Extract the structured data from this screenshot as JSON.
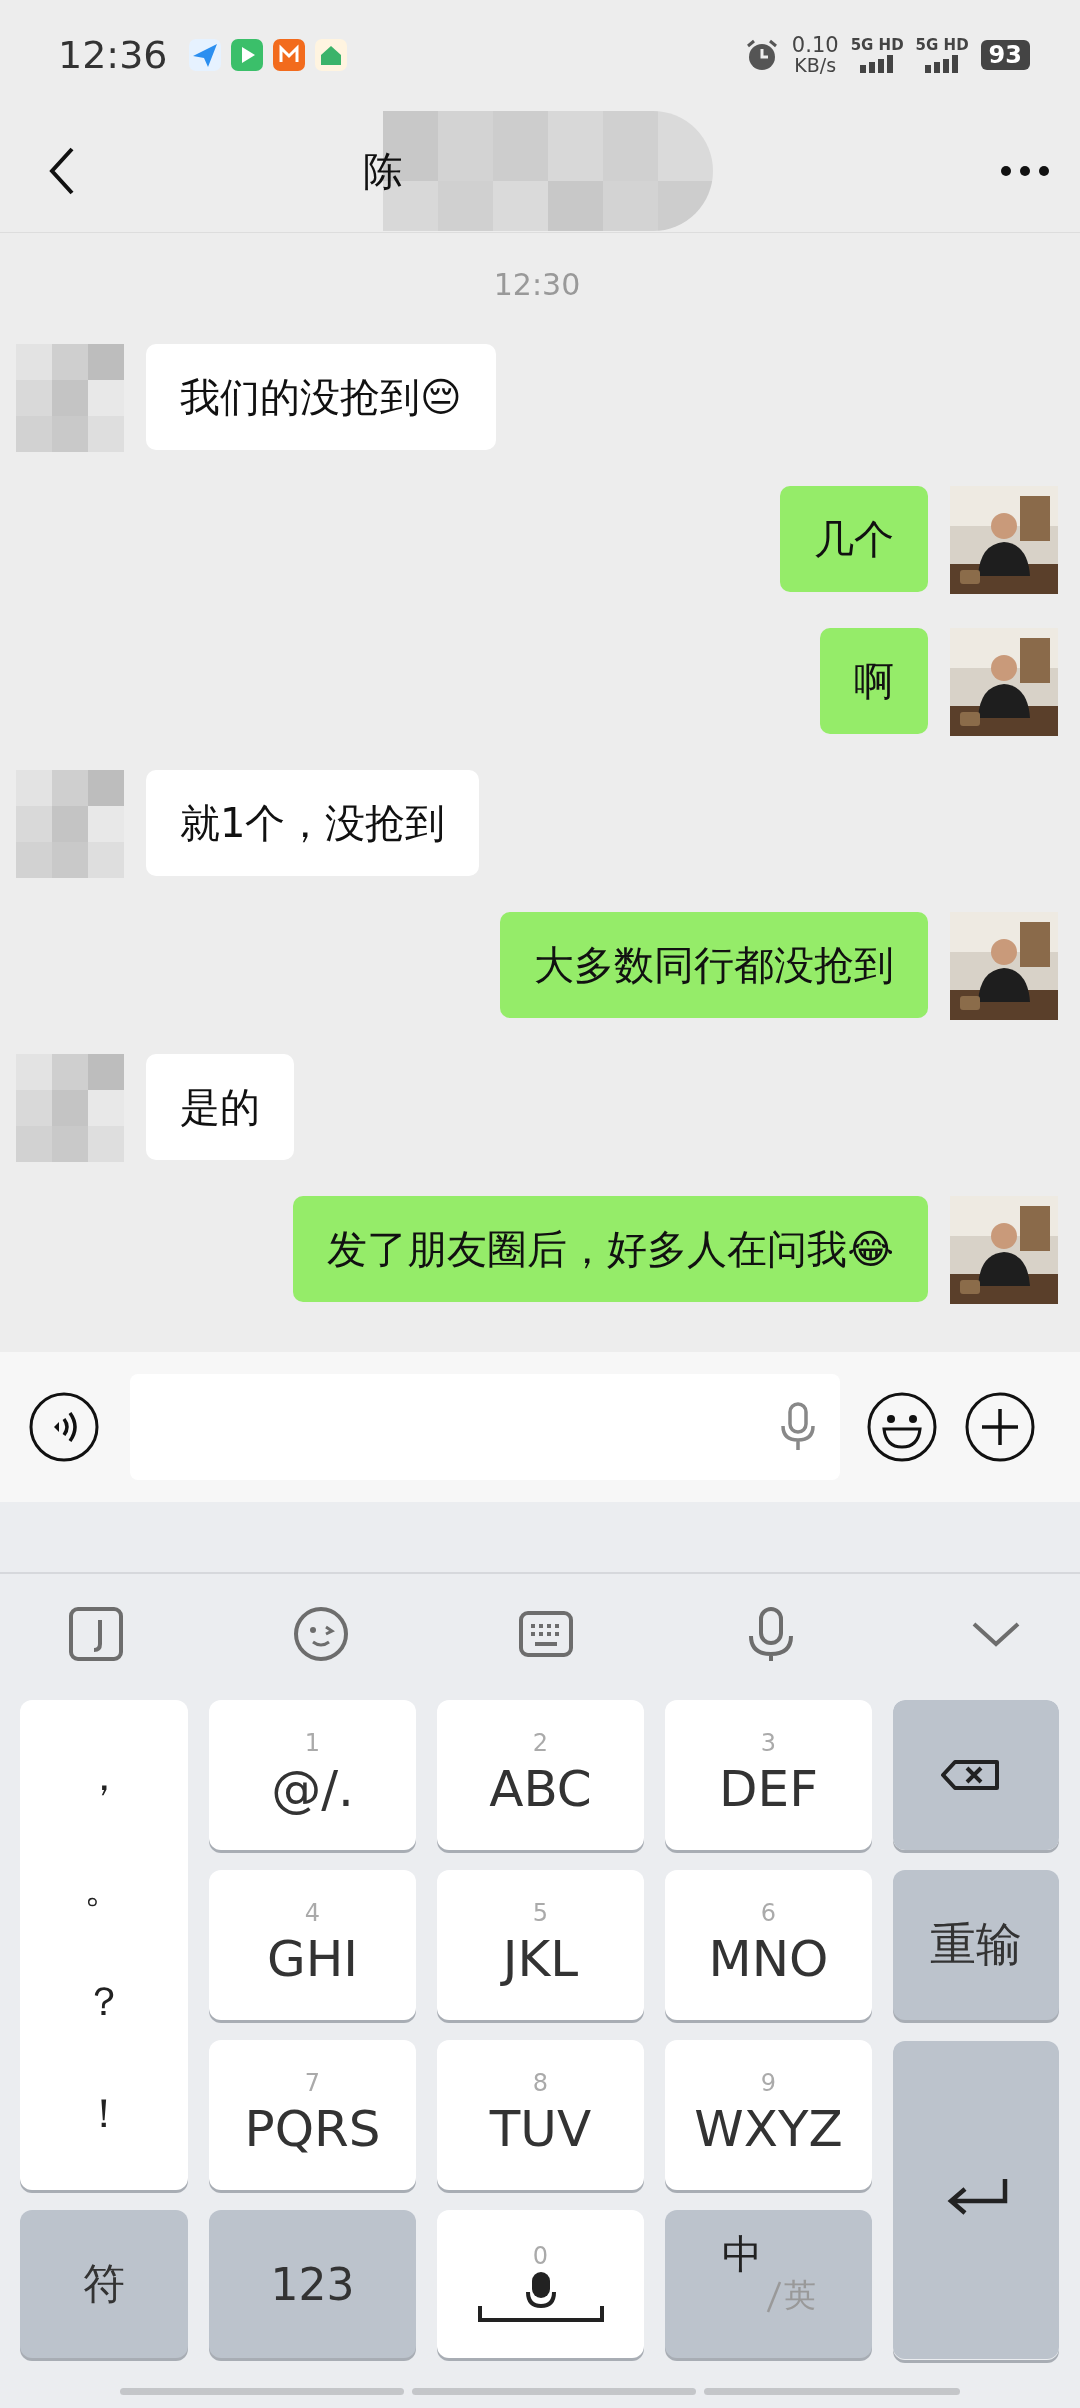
{
  "status_bar": {
    "time": "12:36",
    "net_speed": "0.10",
    "net_unit": "KB/s",
    "sim": [
      "5G HD",
      "5G HD"
    ],
    "battery": "93"
  },
  "header": {
    "title": "陈"
  },
  "chat": {
    "timestamp": "12:30",
    "messages": [
      {
        "kind": "in",
        "text": "我们的没抢到😔"
      },
      {
        "kind": "out",
        "text": "几个"
      },
      {
        "kind": "out",
        "text": "啊"
      },
      {
        "kind": "in",
        "text": "就1个，没抢到"
      },
      {
        "kind": "out",
        "text": "大多数同行都没抢到"
      },
      {
        "kind": "in",
        "text": "是的"
      },
      {
        "kind": "out",
        "text": "发了朋友圈后，好多人在问我😂"
      }
    ]
  },
  "keyboard": {
    "side_keys": [
      "，",
      "。",
      "？",
      "！"
    ],
    "keys": [
      {
        "digit": "1",
        "label": "@/."
      },
      {
        "digit": "2",
        "label": "ABC"
      },
      {
        "digit": "3",
        "label": "DEF"
      },
      {
        "digit": "4",
        "label": "GHI"
      },
      {
        "digit": "5",
        "label": "JKL"
      },
      {
        "digit": "6",
        "label": "MNO"
      },
      {
        "digit": "7",
        "label": "PQRS"
      },
      {
        "digit": "8",
        "label": "TUV"
      },
      {
        "digit": "9",
        "label": "WXYZ"
      }
    ],
    "reset": "重输",
    "symbols": "符",
    "numbers": "123",
    "space_digit": "0",
    "lang_main": "中",
    "lang_alt": "英"
  }
}
